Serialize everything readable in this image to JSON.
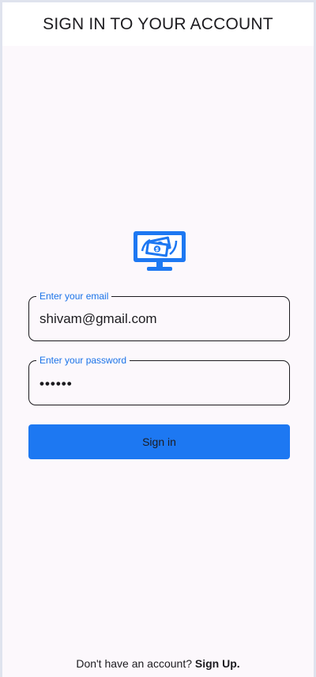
{
  "app_bar": {
    "title": "SIGN IN TO YOUR ACCOUNT"
  },
  "logo": {
    "icon": "monitor-money-icon",
    "color": "#1d78f2"
  },
  "form": {
    "email": {
      "label": "Enter your email",
      "value": "shivam@gmail.com"
    },
    "password": {
      "label": "Enter your password",
      "value": "••••••"
    },
    "submit_label": "Sign in"
  },
  "footer": {
    "prompt": "Don't have an account?",
    "signup_label": "Sign Up."
  },
  "colors": {
    "accent": "#1d78f2",
    "label": "#1a73e8",
    "background": "#fcf8fc",
    "app_bar": "#ffffff"
  }
}
